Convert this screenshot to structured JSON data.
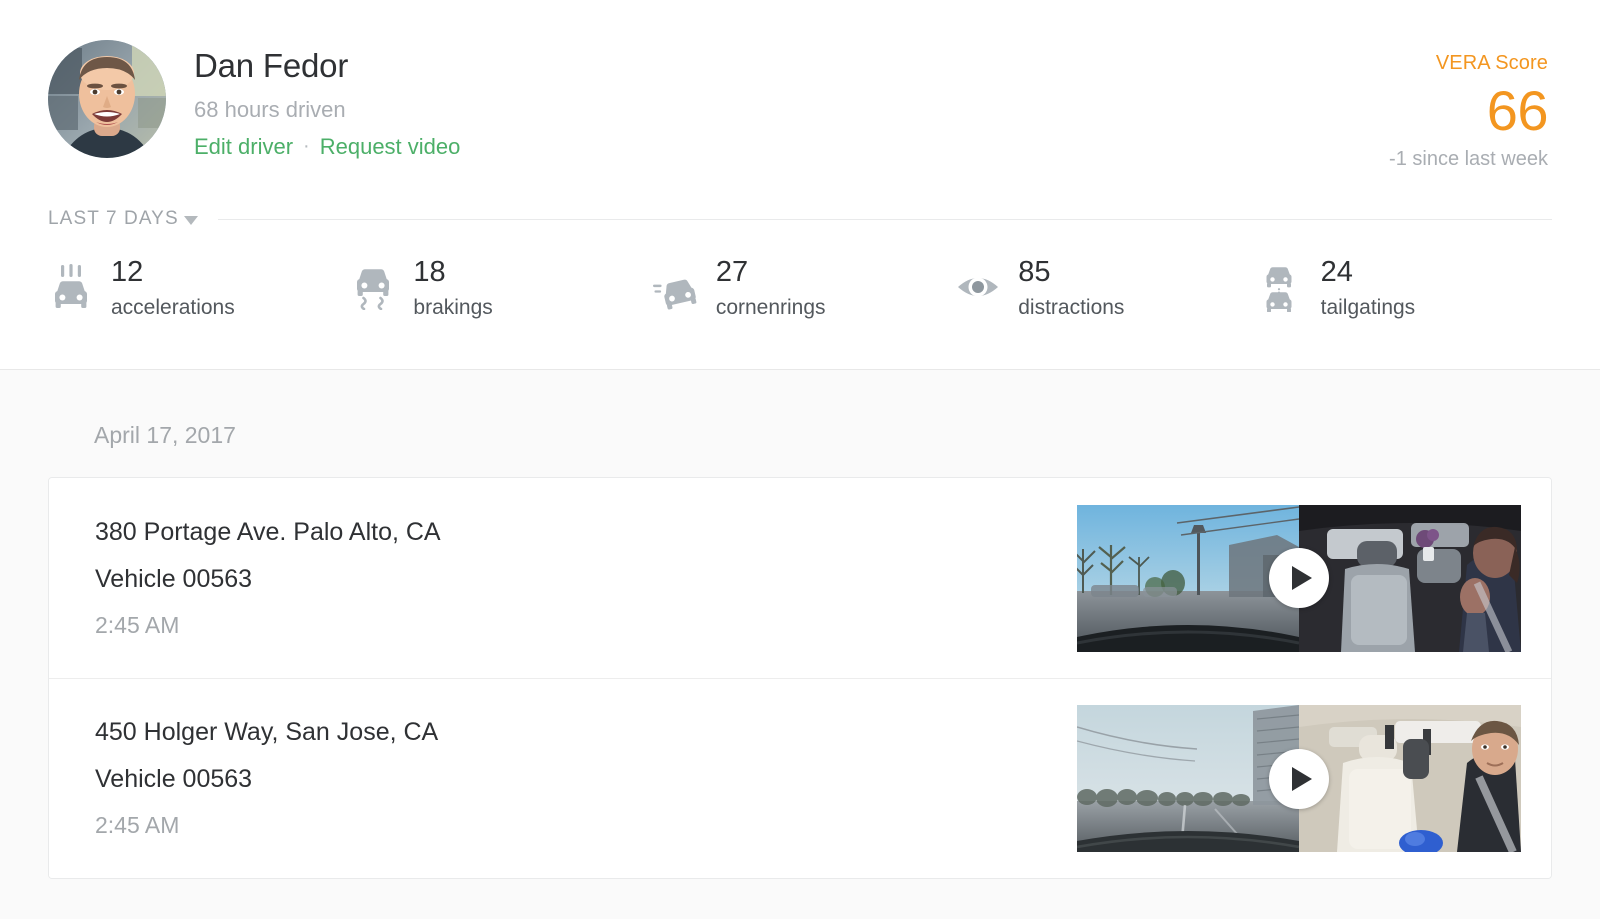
{
  "driver": {
    "name": "Dan Fedor",
    "hours_driven": "68 hours driven",
    "edit_link": "Edit driver",
    "link_separator": "·",
    "request_link": "Request video",
    "avatar_name": "driver-avatar"
  },
  "vera": {
    "label": "VERA Score",
    "score": "66",
    "delta": "-1 since last week",
    "accent_color": "#f39620"
  },
  "period": {
    "selected": "LAST 7 DAYS"
  },
  "stats": [
    {
      "value": "12",
      "label": "accelerations",
      "icon": "car-acceleration-icon"
    },
    {
      "value": "18",
      "label": "brakings",
      "icon": "car-braking-icon"
    },
    {
      "value": "27",
      "label": "cornenrings",
      "icon": "car-cornering-icon"
    },
    {
      "value": "85",
      "label": "distractions",
      "icon": "eye-distraction-icon"
    },
    {
      "value": "24",
      "label": "tailgatings",
      "icon": "car-tailgating-icon"
    }
  ],
  "events": {
    "date_heading": "April 17, 2017",
    "items": [
      {
        "address": "380 Portage Ave. Palo Alto, CA",
        "vehicle": "Vehicle 00563",
        "time": "2:45 AM",
        "thumbnail": {
          "left_view": "road-facing-dashcam",
          "right_view": "cabin-facing-camera",
          "play_icon": "play-icon"
        }
      },
      {
        "address": "450 Holger Way, San Jose, CA",
        "vehicle": "Vehicle 00563",
        "time": "2:45 AM",
        "thumbnail": {
          "left_view": "road-facing-dashcam",
          "right_view": "cabin-facing-camera",
          "play_icon": "play-icon"
        }
      }
    ]
  },
  "colors": {
    "link_green": "#4caf68",
    "accent_orange": "#f39620",
    "text_primary": "#2f3134",
    "text_muted": "#a3a7ab",
    "page_bg": "#fafafa"
  }
}
